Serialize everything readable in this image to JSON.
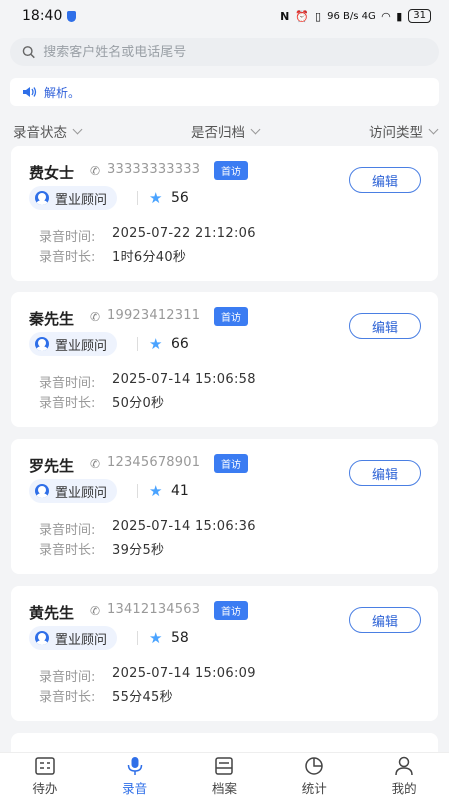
{
  "status_bar": {
    "time": "18:40",
    "right_text": "96 B/s  4G",
    "battery": "31"
  },
  "search": {
    "placeholder": "搜索客户姓名或电话尾号"
  },
  "notice": {
    "text": "解析。"
  },
  "filters": [
    {
      "label": "录音状态"
    },
    {
      "label": "是否归档"
    },
    {
      "label": "访问类型"
    }
  ],
  "labels": {
    "record_time": "录音时间:",
    "record_duration": "录音时长:",
    "edit": "编辑"
  },
  "records": [
    {
      "name": "费女士",
      "phone": "33333333333",
      "badge": "首访",
      "role": "置业顾问",
      "score": "56",
      "time": "2025-07-22 21:12:06",
      "duration": "1时6分40秒"
    },
    {
      "name": "秦先生",
      "phone": "19923412311",
      "badge": "首访",
      "role": "置业顾问",
      "score": "66",
      "time": "2025-07-14 15:06:58",
      "duration": "50分0秒"
    },
    {
      "name": "罗先生",
      "phone": "12345678901",
      "badge": "首访",
      "role": "置业顾问",
      "score": "41",
      "time": "2025-07-14 15:06:36",
      "duration": "39分5秒"
    },
    {
      "name": "黄先生",
      "phone": "13412134563",
      "badge": "首访",
      "role": "置业顾问",
      "score": "58",
      "time": "2025-07-14 15:06:09",
      "duration": "55分45秒"
    }
  ],
  "tabs": [
    {
      "label": "待办",
      "icon": "todo-icon"
    },
    {
      "label": "录音",
      "icon": "microphone-icon",
      "active": true
    },
    {
      "label": "档案",
      "icon": "archive-icon"
    },
    {
      "label": "统计",
      "icon": "pie-chart-icon"
    },
    {
      "label": "我的",
      "icon": "user-icon"
    }
  ],
  "colors": {
    "accent": "#2f6fe8",
    "badge": "#3b7cf2",
    "background": "#f3f4f6"
  }
}
